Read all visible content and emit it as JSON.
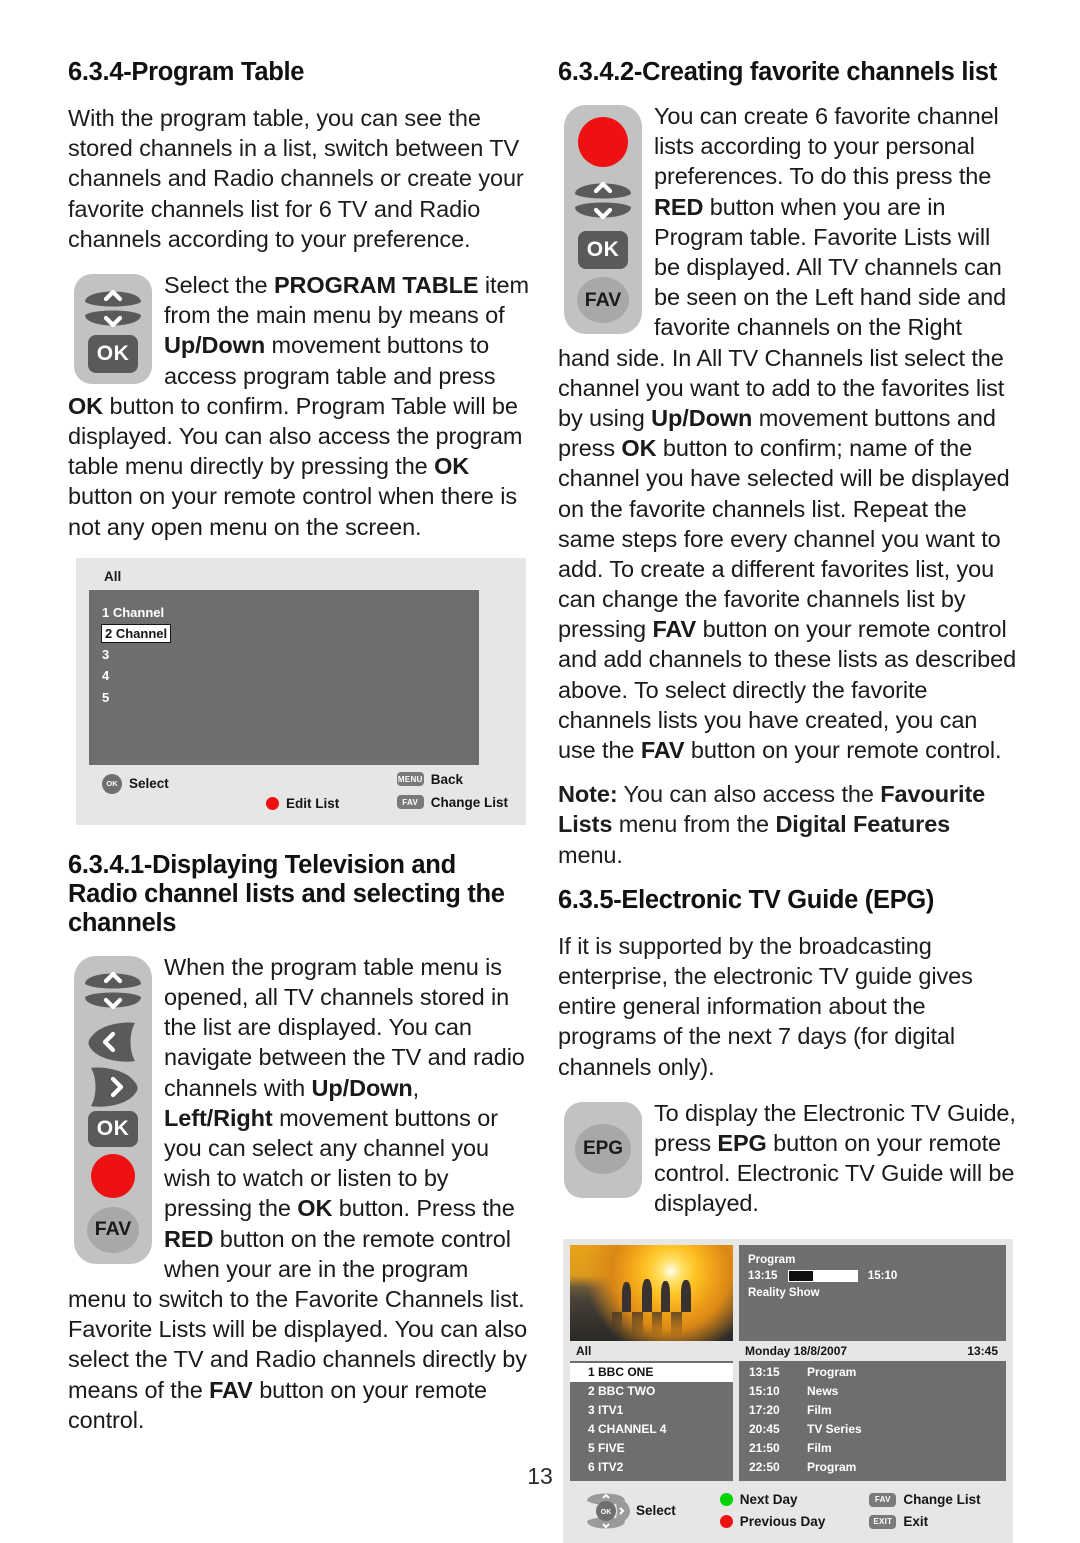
{
  "page_number": "13",
  "left_column": {
    "heading_1": "6.3.4-Program Table",
    "para_1": "With the program table, you can see the stored channels in a list, switch between TV channels and Radio channels or create your favorite channels list for 6 TV and Radio channels according to your preference.",
    "para_2_parts": [
      {
        "t": "Select the ",
        "b": false
      },
      {
        "t": "PROGRAM TABLE",
        "b": true
      },
      {
        "t": " item from the main menu by means of ",
        "b": false
      },
      {
        "t": "Up/Down",
        "b": true
      },
      {
        "t": " movement buttons to access program table and press ",
        "b": false
      },
      {
        "t": "OK",
        "b": true
      },
      {
        "t": " button to confirm. Program Table will be displayed. You can also access the program table menu directly by pressing the ",
        "b": false
      },
      {
        "t": "OK",
        "b": true
      },
      {
        "t": " button on your remote control when there is not any open menu on the screen.",
        "b": false
      }
    ],
    "remote_keys_1": [
      "up-arrow",
      "down-arrow",
      "ok"
    ],
    "heading_2": "6.3.4.1-Displaying Television and Radio channel lists and selecting the channels",
    "para_3_parts": [
      {
        "t": "When the program table menu is opened, all TV channels stored in the list are displayed. You can navigate between the TV and radio channels with ",
        "b": false
      },
      {
        "t": "Up/Down",
        "b": true
      },
      {
        "t": ", ",
        "b": false
      },
      {
        "t": "Left/Right",
        "b": true
      },
      {
        "t": " movement buttons or you can select any channel you wish to watch or listen to by pressing the ",
        "b": false
      },
      {
        "t": "OK",
        "b": true
      },
      {
        "t": " button. Press the ",
        "b": false
      },
      {
        "t": "RED",
        "b": true
      },
      {
        "t": " button on the remote control when your are in the program menu to switch to the Favorite Channels list. Favorite Lists will be displayed. You can also select the TV and Radio channels directly by means of the ",
        "b": false
      },
      {
        "t": "FAV",
        "b": true
      },
      {
        "t": " button on your remote control.",
        "b": false
      }
    ],
    "remote_keys_2": [
      "up-arrow",
      "down-arrow",
      "left-arrow",
      "right-arrow",
      "ok",
      "red",
      "fav"
    ]
  },
  "program_table_osd": {
    "list_title": "All",
    "rows": [
      {
        "label": "1 Channel",
        "selected": false
      },
      {
        "label": "2 Channel",
        "selected": true
      },
      {
        "label": "3",
        "selected": false
      },
      {
        "label": "4",
        "selected": false
      },
      {
        "label": "5",
        "selected": false
      }
    ],
    "legend": {
      "ok_badge": "OK",
      "select": "Select",
      "edit_list": "Edit List",
      "menu_badge": "MENU",
      "back": "Back",
      "fav_badge": "FAV",
      "change_list": "Change List"
    }
  },
  "right_column": {
    "heading_1": "6.3.4.2-Creating favorite channels list",
    "para_1_parts": [
      {
        "t": "You can create 6 favorite channel lists according to your personal preferences. To do this press the ",
        "b": false
      },
      {
        "t": "RED",
        "b": true
      },
      {
        "t": " button when you are in Program table. Favorite Lists will be displayed. All TV channels can be seen on the Left hand side and favorite channels on the Right hand side. In All TV Channels list select the channel you want to add to the favorites list by using ",
        "b": false
      },
      {
        "t": "Up/Down",
        "b": true
      },
      {
        "t": " movement buttons and press ",
        "b": false
      },
      {
        "t": "OK",
        "b": true
      },
      {
        "t": " button to confirm; name of the channel you have selected will be displayed on the favorite channels list. Repeat the same steps fore every channel you want to add. To create a different favorites list, you can change the favorite channels list by pressing ",
        "b": false
      },
      {
        "t": "FAV",
        "b": true
      },
      {
        "t": " button on your remote control and add channels to these lists as described above. To select directly the favorite channels lists you have created, you can use the ",
        "b": false
      },
      {
        "t": "FAV",
        "b": true
      },
      {
        "t": " button on your remote control.",
        "b": false
      }
    ],
    "remote_keys_1": [
      "red",
      "up-arrow",
      "down-arrow",
      "ok",
      "fav"
    ],
    "note_parts": [
      {
        "t": "Note:",
        "b": true
      },
      {
        "t": " You can also access the ",
        "b": false
      },
      {
        "t": "Favourite Lists",
        "b": true
      },
      {
        "t": " menu from the ",
        "b": false
      },
      {
        "t": "Digital Features",
        "b": true
      },
      {
        "t": " menu.",
        "b": false
      }
    ],
    "heading_2": "6.3.5-Electronic TV Guide (EPG)",
    "para_2": "If it is supported  by the broadcasting enterprise, the electronic TV guide gives entire general information about the programs of the next 7 days (for digital channels only).",
    "para_3_parts": [
      {
        "t": "To display the Electronic TV Guide, press ",
        "b": false
      },
      {
        "t": "EPG",
        "b": true
      },
      {
        "t": " button on your remote control. Electronic TV Guide will be displayed.",
        "b": false
      }
    ],
    "remote_keys_2": [
      "epg"
    ]
  },
  "epg_osd": {
    "info_title": "Program",
    "time_start": "13:15",
    "time_end": "15:10",
    "genre": "Reality Show",
    "list_title": "All",
    "date": "Monday 18/8/2007",
    "clock": "13:45",
    "channels": [
      {
        "label": "1 BBC ONE",
        "selected": true
      },
      {
        "label": "2 BBC TWO",
        "selected": false
      },
      {
        "label": "3 ITV1",
        "selected": false
      },
      {
        "label": "4 CHANNEL 4",
        "selected": false
      },
      {
        "label": "5 FIVE",
        "selected": false
      },
      {
        "label": "6 ITV2",
        "selected": false
      }
    ],
    "programs": [
      {
        "time": "13:15",
        "name": "Program"
      },
      {
        "time": "15:10",
        "name": "News"
      },
      {
        "time": "17:20",
        "name": "Film"
      },
      {
        "time": "20:45",
        "name": "TV Series"
      },
      {
        "time": "21:50",
        "name": "Film"
      },
      {
        "time": "22:50",
        "name": "Program"
      }
    ],
    "legend": {
      "ok_badge": "OK",
      "select": "Select",
      "next_day": "Next Day",
      "previous_day": "Previous Day",
      "fav_badge": "FAV",
      "change_list": "Change List",
      "exit_badge": "EXIT",
      "exit": "Exit"
    }
  },
  "colors": {
    "red_button": "#ee1111",
    "green_button": "#00d400",
    "osd_background": "#e6e6e6",
    "osd_screen": "#6e6e6e",
    "remote_body": "#c2c2c2",
    "remote_key": "#5a5a5a"
  }
}
